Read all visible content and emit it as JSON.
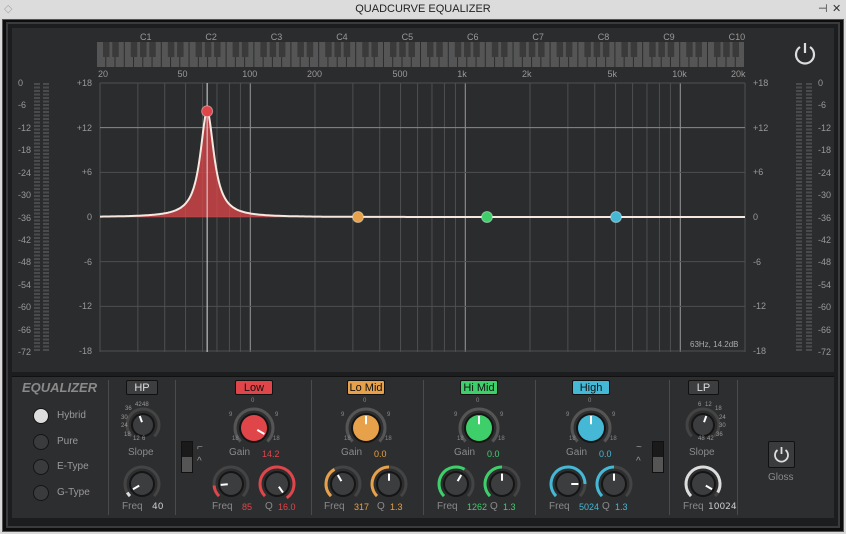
{
  "window": {
    "title": "QUADCURVE EQUALIZER",
    "pin": "⊣",
    "close": "✕"
  },
  "keyboard": {
    "notes": [
      "C1",
      "C2",
      "C3",
      "C4",
      "C5",
      "C6",
      "C7",
      "C8",
      "C9",
      "C10"
    ]
  },
  "freq_axis": [
    "20",
    "50",
    "100",
    "200",
    "500",
    "1k",
    "2k",
    "5k",
    "10k",
    "20k"
  ],
  "db_axis": [
    "+18",
    "+12",
    "+6",
    "0",
    "-6",
    "-12",
    "-18"
  ],
  "meter_axis": [
    "0",
    "-6",
    "-12",
    "-18",
    "-24",
    "-30",
    "-36",
    "-42",
    "-48",
    "-54",
    "-60",
    "-66",
    "-72"
  ],
  "readout": "63Hz, 14.2dB",
  "title": "EQUALIZER",
  "modes": [
    {
      "label": "Hybrid",
      "selected": true
    },
    {
      "label": "Pure",
      "selected": false
    },
    {
      "label": "E-Type",
      "selected": false
    },
    {
      "label": "G-Type",
      "selected": false
    }
  ],
  "hp": {
    "label": "HP",
    "slope_label": "Slope",
    "freq_label": "Freq",
    "freq": "40",
    "slope_ticks": [
      "6",
      "12",
      "18",
      "24",
      "30",
      "36",
      "42",
      "48"
    ]
  },
  "bands": [
    {
      "label": "Low",
      "color": "#e0454a",
      "gain_label": "Gain",
      "gain": "14.2",
      "freq_label": "Freq",
      "freq": "85",
      "q_label": "Q",
      "q": "16.0",
      "freq_hz": 63,
      "gain_db": 14.2
    },
    {
      "label": "Lo Mid",
      "color": "#e6a14a",
      "gain_label": "Gain",
      "gain": "0.0",
      "freq_label": "Freq",
      "freq": "317",
      "q_label": "Q",
      "q": "1.3",
      "freq_hz": 317,
      "gain_db": 0
    },
    {
      "label": "Hi Mid",
      "color": "#3fcf6a",
      "gain_label": "Gain",
      "gain": "0.0",
      "freq_label": "Freq",
      "freq": "1262",
      "q_label": "Q",
      "q": "1.3",
      "freq_hz": 1262,
      "gain_db": 0
    },
    {
      "label": "High",
      "color": "#45b8d6",
      "gain_label": "Gain",
      "gain": "0.0",
      "freq_label": "Freq",
      "freq": "5024",
      "q_label": "Q",
      "q": "1.3",
      "freq_hz": 5024,
      "gain_db": 0
    }
  ],
  "gain_scale": [
    "0",
    "9",
    "9",
    "18",
    "18"
  ],
  "lp": {
    "label": "LP",
    "slope_label": "Slope",
    "freq_label": "Freq",
    "freq": "10024"
  },
  "gloss": {
    "label": "Gloss"
  }
}
